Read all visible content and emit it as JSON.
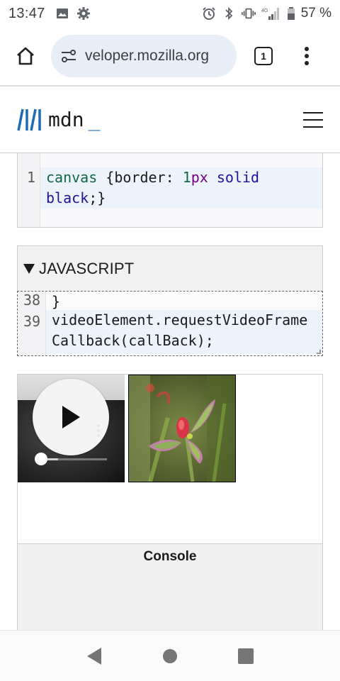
{
  "status_bar": {
    "time": "13:47",
    "left_icons": [
      "image-icon",
      "gear-icon"
    ],
    "right_icons": [
      "alarm-icon",
      "bluetooth-icon",
      "vibrate-icon",
      "signal-icon",
      "battery-icon"
    ],
    "network_label": "4G",
    "battery_percent": "57 %"
  },
  "browser": {
    "url": "veloper.mozilla.org",
    "tab_count": "1"
  },
  "mdn": {
    "wordmark": "mdn",
    "underscore": "_"
  },
  "css_editor": {
    "line_numbers": [
      "1"
    ],
    "tokens": {
      "selector": "canvas",
      "open": " {",
      "property": "border",
      "colon": ": ",
      "number": "1",
      "unit": "px",
      "value1": " solid",
      "value2": "black",
      "close": ";}"
    }
  },
  "js_section": {
    "title": "JAVASCRIPT",
    "line_numbers": [
      "38",
      "39"
    ],
    "line38": "}",
    "line39_a": "videoElement.requestVideoFrame",
    "line39_b": "Callback(callBack);"
  },
  "video": {
    "progress": 0.25
  },
  "console": {
    "title": "Console"
  },
  "colors": {
    "mdn_blue": "#1e6bb8",
    "code_highlight": "#edf3fb",
    "console_bg": "#f0f0f0"
  }
}
